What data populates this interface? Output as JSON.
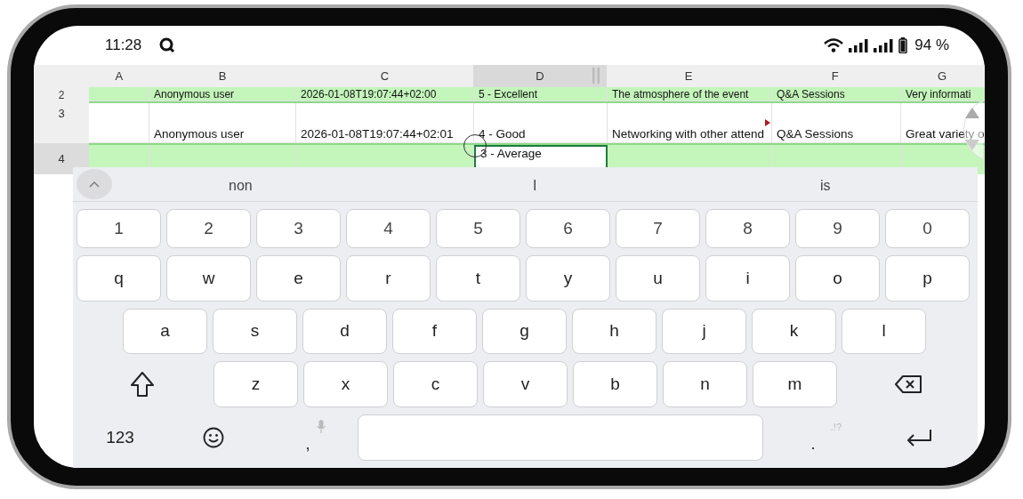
{
  "status_bar": {
    "time": "11:28",
    "battery": "94 %"
  },
  "sheet": {
    "columns": [
      {
        "label": "A",
        "selected": false
      },
      {
        "label": "B",
        "selected": false
      },
      {
        "label": "C",
        "selected": false
      },
      {
        "label": "D",
        "selected": true
      },
      {
        "label": "E",
        "selected": false
      },
      {
        "label": "F",
        "selected": false
      },
      {
        "label": "G",
        "selected": false
      }
    ],
    "rows": [
      {
        "number": "2",
        "selected": false,
        "highlighted": true,
        "cells": [
          null,
          {
            "text": "Anonymous user",
            "selected": false,
            "comment": false
          },
          {
            "text": "2026-01-08T19:07:44+02:00",
            "selected": false,
            "comment": false
          },
          {
            "text": "5 - Excellent",
            "selected": false,
            "comment": false
          },
          {
            "text": "The atmosphere of the event",
            "selected": false,
            "comment": false
          },
          {
            "text": "Q&A Sessions",
            "selected": false,
            "comment": false
          },
          {
            "text": "Very informati",
            "selected": false,
            "comment": false
          }
        ]
      },
      {
        "number": "3",
        "selected": false,
        "highlighted": false,
        "cells": [
          null,
          {
            "text": "Anonymous user",
            "selected": false,
            "comment": false
          },
          {
            "text": "2026-01-08T19:07:44+02:01",
            "selected": false,
            "comment": false
          },
          {
            "text": "4 - Good",
            "selected": false,
            "comment": false
          },
          {
            "text": "Networking with other attend",
            "selected": false,
            "comment": true
          },
          {
            "text": "Q&A Sessions",
            "selected": false,
            "comment": false
          },
          {
            "text": "Great variety o",
            "selected": false,
            "comment": false
          }
        ]
      },
      {
        "number": "4",
        "selected": true,
        "highlighted": true,
        "cells": [
          null,
          null,
          null,
          {
            "text": "3 - Average",
            "selected": true,
            "comment": false
          },
          null,
          null,
          null
        ]
      }
    ]
  },
  "keyboard": {
    "suggestions": [
      "non",
      "I",
      "is"
    ],
    "rows": [
      [
        {
          "kind": "char",
          "label": "1"
        },
        {
          "kind": "char",
          "label": "2"
        },
        {
          "kind": "char",
          "label": "3"
        },
        {
          "kind": "char",
          "label": "4"
        },
        {
          "kind": "char",
          "label": "5"
        },
        {
          "kind": "char",
          "label": "6"
        },
        {
          "kind": "char",
          "label": "7"
        },
        {
          "kind": "char",
          "label": "8"
        },
        {
          "kind": "char",
          "label": "9"
        },
        {
          "kind": "char",
          "label": "0"
        }
      ],
      [
        {
          "kind": "char",
          "label": "q"
        },
        {
          "kind": "char",
          "label": "w"
        },
        {
          "kind": "char",
          "label": "e"
        },
        {
          "kind": "char",
          "label": "r"
        },
        {
          "kind": "char",
          "label": "t"
        },
        {
          "kind": "char",
          "label": "y"
        },
        {
          "kind": "char",
          "label": "u"
        },
        {
          "kind": "char",
          "label": "i"
        },
        {
          "kind": "char",
          "label": "o"
        },
        {
          "kind": "char",
          "label": "p"
        }
      ],
      [
        {
          "kind": "char",
          "label": "a"
        },
        {
          "kind": "char",
          "label": "s"
        },
        {
          "kind": "char",
          "label": "d"
        },
        {
          "kind": "char",
          "label": "f"
        },
        {
          "kind": "char",
          "label": "g"
        },
        {
          "kind": "char",
          "label": "h"
        },
        {
          "kind": "char",
          "label": "j"
        },
        {
          "kind": "char",
          "label": "k"
        },
        {
          "kind": "char",
          "label": "l"
        }
      ],
      [
        {
          "kind": "shift"
        },
        {
          "kind": "char",
          "label": "z"
        },
        {
          "kind": "char",
          "label": "x"
        },
        {
          "kind": "char",
          "label": "c"
        },
        {
          "kind": "char",
          "label": "v"
        },
        {
          "kind": "char",
          "label": "b"
        },
        {
          "kind": "char",
          "label": "n"
        },
        {
          "kind": "char",
          "label": "m"
        },
        {
          "kind": "backspace"
        }
      ]
    ],
    "bottom_bar": {
      "mode_key": "123",
      "comma_key": ",",
      "period_key": ".",
      "period_hint": ".!?"
    }
  }
}
